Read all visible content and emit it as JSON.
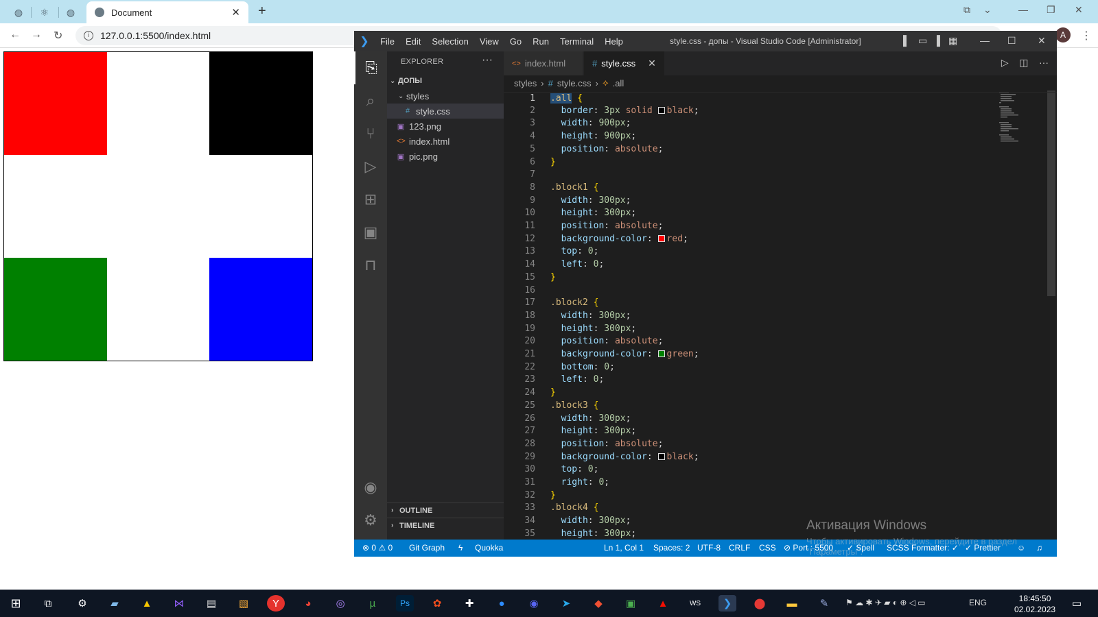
{
  "browser": {
    "tab_title": "Document",
    "url": "127.0.0.1:5500/index.html",
    "profile_initial": "A"
  },
  "page": {
    "blocks": [
      {
        "name": "red",
        "color": "#ff0000",
        "corner": "top-left"
      },
      {
        "name": "black",
        "color": "#000000",
        "corner": "top-right"
      },
      {
        "name": "green",
        "color": "#008000",
        "corner": "bottom-left"
      },
      {
        "name": "blue",
        "color": "#0000ff",
        "corner": "bottom-right"
      }
    ]
  },
  "vscode": {
    "menu": [
      "File",
      "Edit",
      "Selection",
      "View",
      "Go",
      "Run",
      "Terminal",
      "Help"
    ],
    "window_title": "style.css - допы - Visual Studio Code [Administrator]",
    "explorer_title": "EXPLORER",
    "explorer_more": "···",
    "tree": {
      "root": "ДОПЫ",
      "folder": "styles",
      "files": [
        "style.css",
        "123.png",
        "index.html",
        "pic.png"
      ]
    },
    "outline_label": "OUTLINE",
    "timeline_label": "TIMELINE",
    "tabs": [
      {
        "label": "index.html",
        "icon": "<>",
        "active": false
      },
      {
        "label": "style.css",
        "icon": "#",
        "active": true
      }
    ],
    "breadcrumb": [
      "styles",
      "style.css",
      ".all"
    ],
    "code_lines": [
      {
        "n": "1",
        "parts": [
          [
            ".all",
            "sel"
          ],
          [
            " {",
            "brace"
          ]
        ]
      },
      {
        "n": "2",
        "parts": [
          [
            "  border",
            "prop"
          ],
          [
            ": ",
            "punc"
          ],
          [
            "3px",
            "num"
          ],
          [
            " solid ",
            "val"
          ],
          [
            "#000000",
            "swatch"
          ],
          [
            "black",
            "val"
          ],
          [
            ";",
            "punc"
          ]
        ]
      },
      {
        "n": "3",
        "parts": [
          [
            "  width",
            "prop"
          ],
          [
            ": ",
            "punc"
          ],
          [
            "900px",
            "num"
          ],
          [
            ";",
            "punc"
          ]
        ]
      },
      {
        "n": "4",
        "parts": [
          [
            "  height",
            "prop"
          ],
          [
            ": ",
            "punc"
          ],
          [
            "900px",
            "num"
          ],
          [
            ";",
            "punc"
          ]
        ]
      },
      {
        "n": "5",
        "parts": [
          [
            "  position",
            "prop"
          ],
          [
            ": ",
            "punc"
          ],
          [
            "absolute",
            "val"
          ],
          [
            ";",
            "punc"
          ]
        ]
      },
      {
        "n": "6",
        "parts": [
          [
            "}",
            "brace"
          ]
        ]
      },
      {
        "n": "7",
        "parts": []
      },
      {
        "n": "8",
        "parts": [
          [
            ".block1",
            "sel"
          ],
          [
            " {",
            "brace"
          ]
        ]
      },
      {
        "n": "9",
        "parts": [
          [
            "  width",
            "prop"
          ],
          [
            ": ",
            "punc"
          ],
          [
            "300px",
            "num"
          ],
          [
            ";",
            "punc"
          ]
        ]
      },
      {
        "n": "10",
        "parts": [
          [
            "  height",
            "prop"
          ],
          [
            ": ",
            "punc"
          ],
          [
            "300px",
            "num"
          ],
          [
            ";",
            "punc"
          ]
        ]
      },
      {
        "n": "11",
        "parts": [
          [
            "  position",
            "prop"
          ],
          [
            ": ",
            "punc"
          ],
          [
            "absolute",
            "val"
          ],
          [
            ";",
            "punc"
          ]
        ]
      },
      {
        "n": "12",
        "parts": [
          [
            "  background-color",
            "prop"
          ],
          [
            ": ",
            "punc"
          ],
          [
            "#ff0000",
            "swatch"
          ],
          [
            "red",
            "val"
          ],
          [
            ";",
            "punc"
          ]
        ]
      },
      {
        "n": "13",
        "parts": [
          [
            "  top",
            "prop"
          ],
          [
            ": ",
            "punc"
          ],
          [
            "0",
            "num"
          ],
          [
            ";",
            "punc"
          ]
        ]
      },
      {
        "n": "14",
        "parts": [
          [
            "  left",
            "prop"
          ],
          [
            ": ",
            "punc"
          ],
          [
            "0",
            "num"
          ],
          [
            ";",
            "punc"
          ]
        ]
      },
      {
        "n": "15",
        "parts": [
          [
            "}",
            "brace"
          ]
        ]
      },
      {
        "n": "16",
        "parts": []
      },
      {
        "n": "17",
        "parts": [
          [
            ".block2",
            "sel"
          ],
          [
            " {",
            "brace"
          ]
        ]
      },
      {
        "n": "18",
        "parts": [
          [
            "  width",
            "prop"
          ],
          [
            ": ",
            "punc"
          ],
          [
            "300px",
            "num"
          ],
          [
            ";",
            "punc"
          ]
        ]
      },
      {
        "n": "19",
        "parts": [
          [
            "  height",
            "prop"
          ],
          [
            ": ",
            "punc"
          ],
          [
            "300px",
            "num"
          ],
          [
            ";",
            "punc"
          ]
        ]
      },
      {
        "n": "20",
        "parts": [
          [
            "  position",
            "prop"
          ],
          [
            ": ",
            "punc"
          ],
          [
            "absolute",
            "val"
          ],
          [
            ";",
            "punc"
          ]
        ]
      },
      {
        "n": "21",
        "parts": [
          [
            "  background-color",
            "prop"
          ],
          [
            ": ",
            "punc"
          ],
          [
            "#008000",
            "swatch"
          ],
          [
            "green",
            "val"
          ],
          [
            ";",
            "punc"
          ]
        ]
      },
      {
        "n": "22",
        "parts": [
          [
            "  bottom",
            "prop"
          ],
          [
            ": ",
            "punc"
          ],
          [
            "0",
            "num"
          ],
          [
            ";",
            "punc"
          ]
        ]
      },
      {
        "n": "23",
        "parts": [
          [
            "  left",
            "prop"
          ],
          [
            ": ",
            "punc"
          ],
          [
            "0",
            "num"
          ],
          [
            ";",
            "punc"
          ]
        ]
      },
      {
        "n": "24",
        "parts": [
          [
            "}",
            "brace"
          ]
        ]
      },
      {
        "n": "25",
        "parts": [
          [
            ".block3",
            "sel"
          ],
          [
            " {",
            "brace"
          ]
        ]
      },
      {
        "n": "26",
        "parts": [
          [
            "  width",
            "prop"
          ],
          [
            ": ",
            "punc"
          ],
          [
            "300px",
            "num"
          ],
          [
            ";",
            "punc"
          ]
        ]
      },
      {
        "n": "27",
        "parts": [
          [
            "  height",
            "prop"
          ],
          [
            ": ",
            "punc"
          ],
          [
            "300px",
            "num"
          ],
          [
            ";",
            "punc"
          ]
        ]
      },
      {
        "n": "28",
        "parts": [
          [
            "  position",
            "prop"
          ],
          [
            ": ",
            "punc"
          ],
          [
            "absolute",
            "val"
          ],
          [
            ";",
            "punc"
          ]
        ]
      },
      {
        "n": "29",
        "parts": [
          [
            "  background-color",
            "prop"
          ],
          [
            ": ",
            "punc"
          ],
          [
            "#000000",
            "swatch"
          ],
          [
            "black",
            "val"
          ],
          [
            ";",
            "punc"
          ]
        ]
      },
      {
        "n": "30",
        "parts": [
          [
            "  top",
            "prop"
          ],
          [
            ": ",
            "punc"
          ],
          [
            "0",
            "num"
          ],
          [
            ";",
            "punc"
          ]
        ]
      },
      {
        "n": "31",
        "parts": [
          [
            "  right",
            "prop"
          ],
          [
            ": ",
            "punc"
          ],
          [
            "0",
            "num"
          ],
          [
            ";",
            "punc"
          ]
        ]
      },
      {
        "n": "32",
        "parts": [
          [
            "}",
            "brace"
          ]
        ]
      },
      {
        "n": "33",
        "parts": [
          [
            ".block4",
            "sel"
          ],
          [
            " {",
            "brace"
          ]
        ]
      },
      {
        "n": "34",
        "parts": [
          [
            "  width",
            "prop"
          ],
          [
            ": ",
            "punc"
          ],
          [
            "300px",
            "num"
          ],
          [
            ";",
            "punc"
          ]
        ]
      },
      {
        "n": "35",
        "parts": [
          [
            "  height",
            "prop"
          ],
          [
            ": ",
            "punc"
          ],
          [
            "300px",
            "num"
          ],
          [
            ";",
            "punc"
          ]
        ]
      }
    ],
    "status": {
      "problems": "⊗ 0 ⚠ 0",
      "git_graph": "Git Graph",
      "quokka": "Quokka",
      "cursor": "Ln 1, Col 1",
      "spaces": "Spaces: 2",
      "encoding": "UTF-8",
      "eol": "CRLF",
      "language": "CSS",
      "port": "⊘ Port : 5500",
      "spell": "✓ Spell",
      "scss": "SCSS Formatter: ✓",
      "prettier": "✓ Prettier"
    }
  },
  "windows": {
    "activation_title": "Активация Windows",
    "activation_text": "Чтобы активировать Windows, перейдите в раздел",
    "activation_text2": "\"Параметры\".",
    "language": "ENG",
    "time": "18:45:50",
    "date": "02.02.2023"
  },
  "colors": {
    "vscode_accent": "#007acc",
    "taskbar_bg": "#0e1623",
    "browser_tabbar": "#bde3f1"
  }
}
